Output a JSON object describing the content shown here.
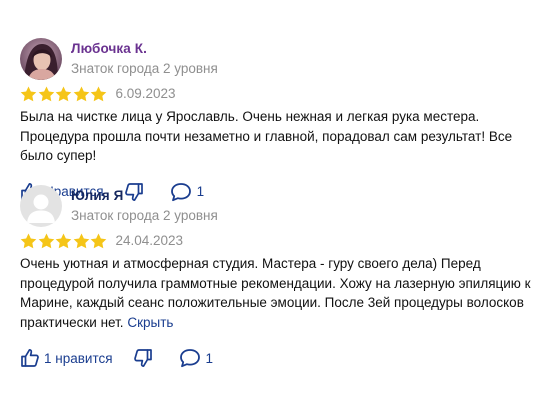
{
  "colors": {
    "star": "#f5c518",
    "link": "#1a3d8f",
    "muted": "#8f8f8f",
    "name_purple": "#6a3290",
    "name_navy": "#15275e"
  },
  "reviews": [
    {
      "author": "Любочка К.",
      "level": "Знаток города 2 уровня",
      "rating": 5,
      "date": "6.09.2023",
      "text": "Была на чистке лица у Ярославль. Очень нежная и легкая рука местера. Процедура прошла почти незаметно и главной, порадовал сам результат! Все было супер!",
      "like_label": "Нравится",
      "comments_count": "1",
      "avatar_icon": "user-photo-avatar"
    },
    {
      "author": "Юлия Я",
      "level": "Знаток города 2 уровня",
      "rating": 5,
      "date": "24.04.2023",
      "text": "Очень уютная и атмосферная студия. Мастера - гуру своего дела) Перед процедурой получила граммотные рекомендации. Хожу на лазерную эпиляцию к Марине, каждый сеанс положительные эмоции. После 3ей процедуры волосков практически нет.",
      "collapse_label": "Скрыть",
      "like_label": "1 нравится",
      "comments_count": "1",
      "avatar_icon": "default-user-avatar"
    }
  ]
}
